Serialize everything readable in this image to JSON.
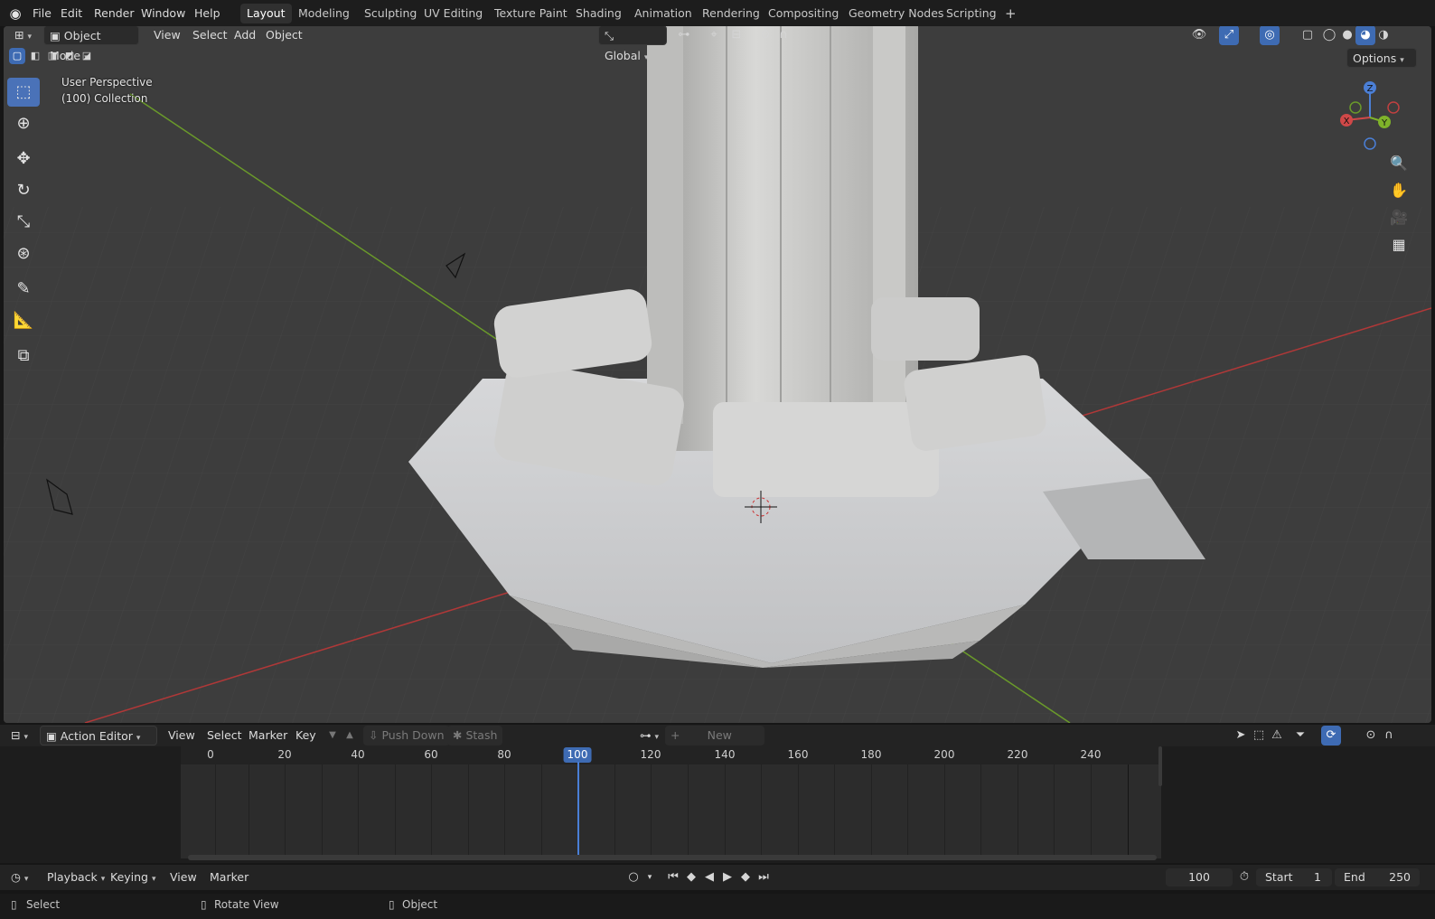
{
  "app": {
    "menus": [
      "File",
      "Edit",
      "Render",
      "Window",
      "Help"
    ],
    "workspaces": [
      "Layout",
      "Modeling",
      "Sculpting",
      "UV Editing",
      "Texture Paint",
      "Shading",
      "Animation",
      "Rendering",
      "Compositing",
      "Geometry Nodes",
      "Scripting"
    ],
    "active_workspace": "Layout",
    "add_workspace_icon": "plus-icon"
  },
  "viewport": {
    "mode": "Object Mode",
    "menus": [
      "View",
      "Select",
      "Add",
      "Object"
    ],
    "transform_orientation": "Global",
    "options_label": "Options",
    "overlay_line1": "User Perspective",
    "overlay_line2": "(100) Collection",
    "gizmo": {
      "x": "X",
      "y": "Y",
      "z": "Z"
    },
    "colors": {
      "background": "#3d3d3d",
      "x_axis": "#c03a3a",
      "y_axis": "#6a9a2a",
      "active": "#4a72b8"
    }
  },
  "action_editor": {
    "editor_type": "Action Editor",
    "menus": [
      "View",
      "Select",
      "Marker",
      "Key"
    ],
    "push_down": "Push Down",
    "stash": "Stash",
    "new_label": "New",
    "ticks": [
      "0",
      "20",
      "40",
      "60",
      "80",
      "100",
      "120",
      "140",
      "160",
      "180",
      "200",
      "220",
      "240"
    ],
    "current_frame": "100"
  },
  "timeline": {
    "playback": "Playback",
    "keying": "Keying",
    "view": "View",
    "marker": "Marker",
    "current_frame": "100",
    "start_label": "Start",
    "start_value": "1",
    "end_label": "End",
    "end_value": "250"
  },
  "statusbar": {
    "select": "Select",
    "rotate": "Rotate View",
    "object": "Object"
  }
}
